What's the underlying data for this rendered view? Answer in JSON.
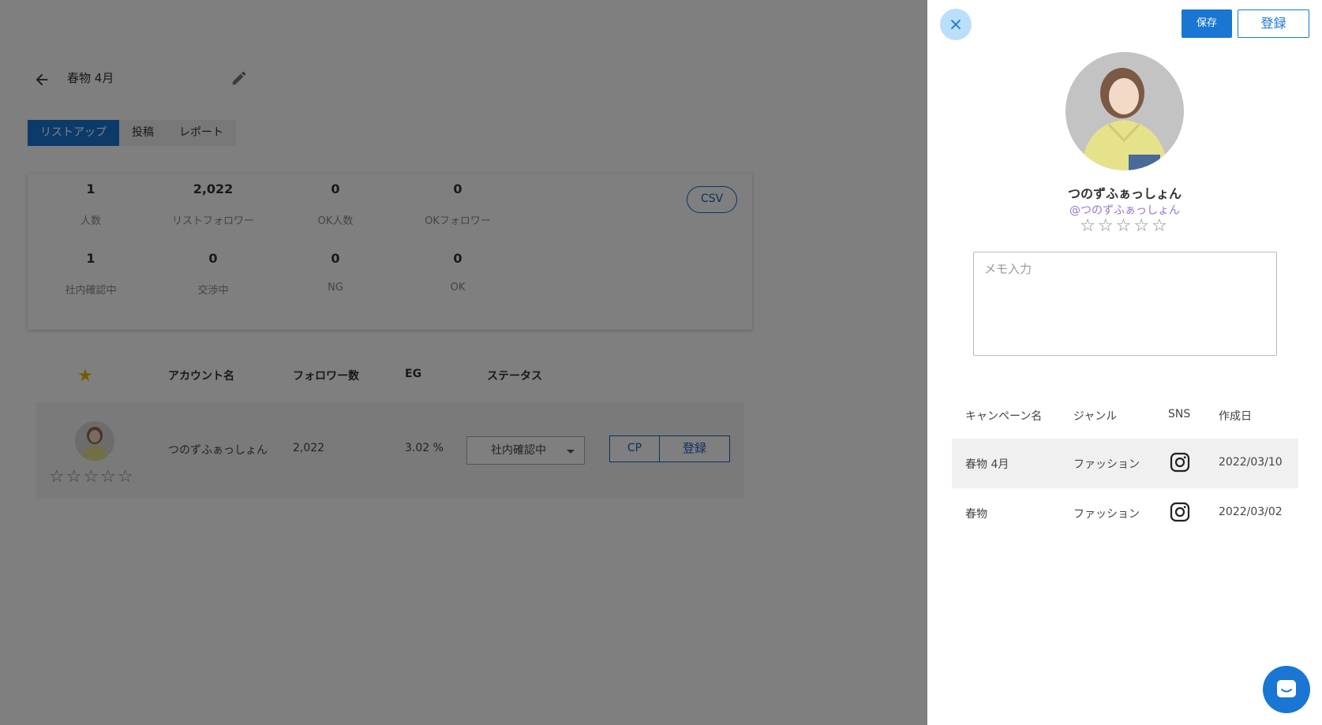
{
  "page": {
    "title": "春物 4月",
    "tabs": [
      "リストアップ",
      "投稿",
      "レポート"
    ],
    "csv_label": "CSV",
    "stats": [
      {
        "value": "1",
        "label": "人数"
      },
      {
        "value": "2,022",
        "label": "リストフォロワー"
      },
      {
        "value": "0",
        "label": "OK人数"
      },
      {
        "value": "0",
        "label": "OKフォロワー"
      },
      {
        "value": "1",
        "label": "社内確認中"
      },
      {
        "value": "0",
        "label": "交渉中"
      },
      {
        "value": "0",
        "label": "NG"
      },
      {
        "value": "0",
        "label": "OK"
      }
    ],
    "table": {
      "headers": {
        "account": "アカウント名",
        "followers": "フォロワー数",
        "eg": "EG",
        "status": "ステータス"
      },
      "rows": [
        {
          "account": "つのずふぁっしょん",
          "followers": "2,022",
          "eg": "3.02 %",
          "status": "社内確認中",
          "cp_label": "CP",
          "register_label": "登録",
          "stars": "☆☆☆☆☆"
        }
      ]
    }
  },
  "panel": {
    "save_label": "保存",
    "register_label": "登録",
    "profile": {
      "name": "つのずふぁっしょん",
      "handle": "@つのずふぁっしょん",
      "stars": "☆☆☆☆☆"
    },
    "memo_placeholder": "メモ入力",
    "campaign_table": {
      "headers": [
        "キャンペーン名",
        "ジャンル",
        "SNS",
        "作成日"
      ],
      "rows": [
        {
          "name": "春物 4月",
          "genre": "ファッション",
          "sns": "instagram-icon",
          "date": "2022/03/10"
        },
        {
          "name": "春物",
          "genre": "ファッション",
          "sns": "instagram-icon",
          "date": "2022/03/02"
        }
      ]
    }
  },
  "colors": {
    "primary": "#1976d2",
    "handle": "#9575cd",
    "star_gold": "#e6b800",
    "overlay": "rgba(0,0,0,0.5)"
  }
}
